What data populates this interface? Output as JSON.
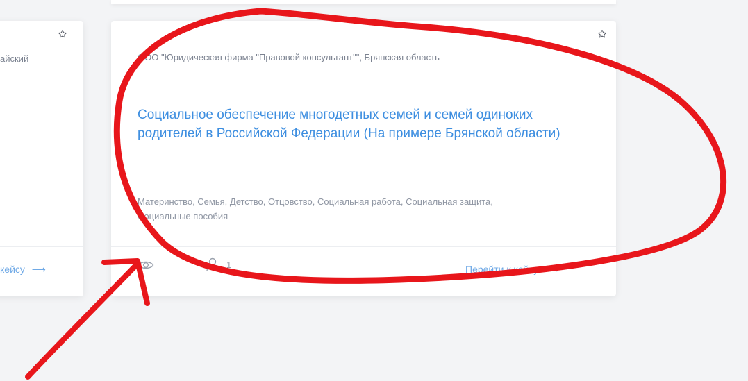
{
  "cards": {
    "left": {
      "org_fragment": "айский",
      "goto_fragment": "кейсу",
      "arrow": "⟶"
    },
    "main": {
      "org": "ООО \"Юридическая фирма \"Правовой консультант\"\", Брянская область",
      "title": "Социальное обеспечение многодетных семей и семей одиноких родителей в Российской Федерации (На примере Брянской области)",
      "tags": "Материнство, Семья, Детство, Отцовство, Социальная работа, Социальная защита, Социальные пособия",
      "views_count": "",
      "participants_count": "1",
      "goto_label": "Перейти к кейсу",
      "arrow": "⟶"
    }
  },
  "icons": {
    "favorite": "star-icon",
    "views": "eye-icon",
    "participants": "user-icon",
    "goto": "arrow-right-icon"
  },
  "annotation": {
    "marker_color": "#e8161b",
    "shapes": [
      "ellipse",
      "arrow"
    ]
  },
  "colors": {
    "title": "#3d8ee0",
    "link": "#6fa9e6",
    "muted_text": "#8f96a3",
    "background": "#f3f4f6"
  }
}
